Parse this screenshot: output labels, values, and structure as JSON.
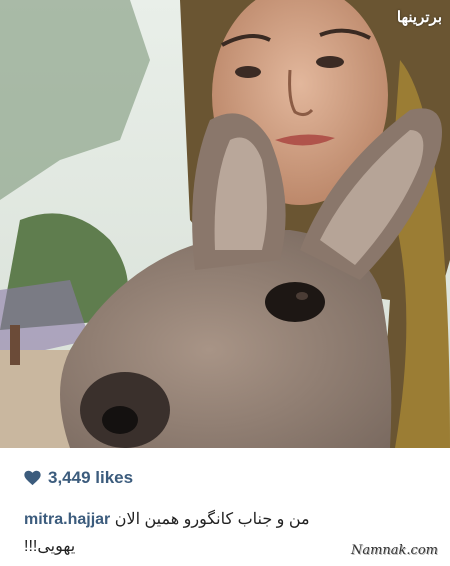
{
  "photo": {
    "description_icon": "photo-icon",
    "top_watermark": "برترینها"
  },
  "likes": {
    "icon": "heart-icon",
    "count_text": "3,449 likes",
    "color": "#3c5c7d"
  },
  "caption": {
    "username": "mitra.hajjar",
    "text_line1": "من و جناب کانگورو همین الان",
    "text_line2": "!!!یهویی"
  },
  "watermark": {
    "text": "Namnak.com"
  }
}
